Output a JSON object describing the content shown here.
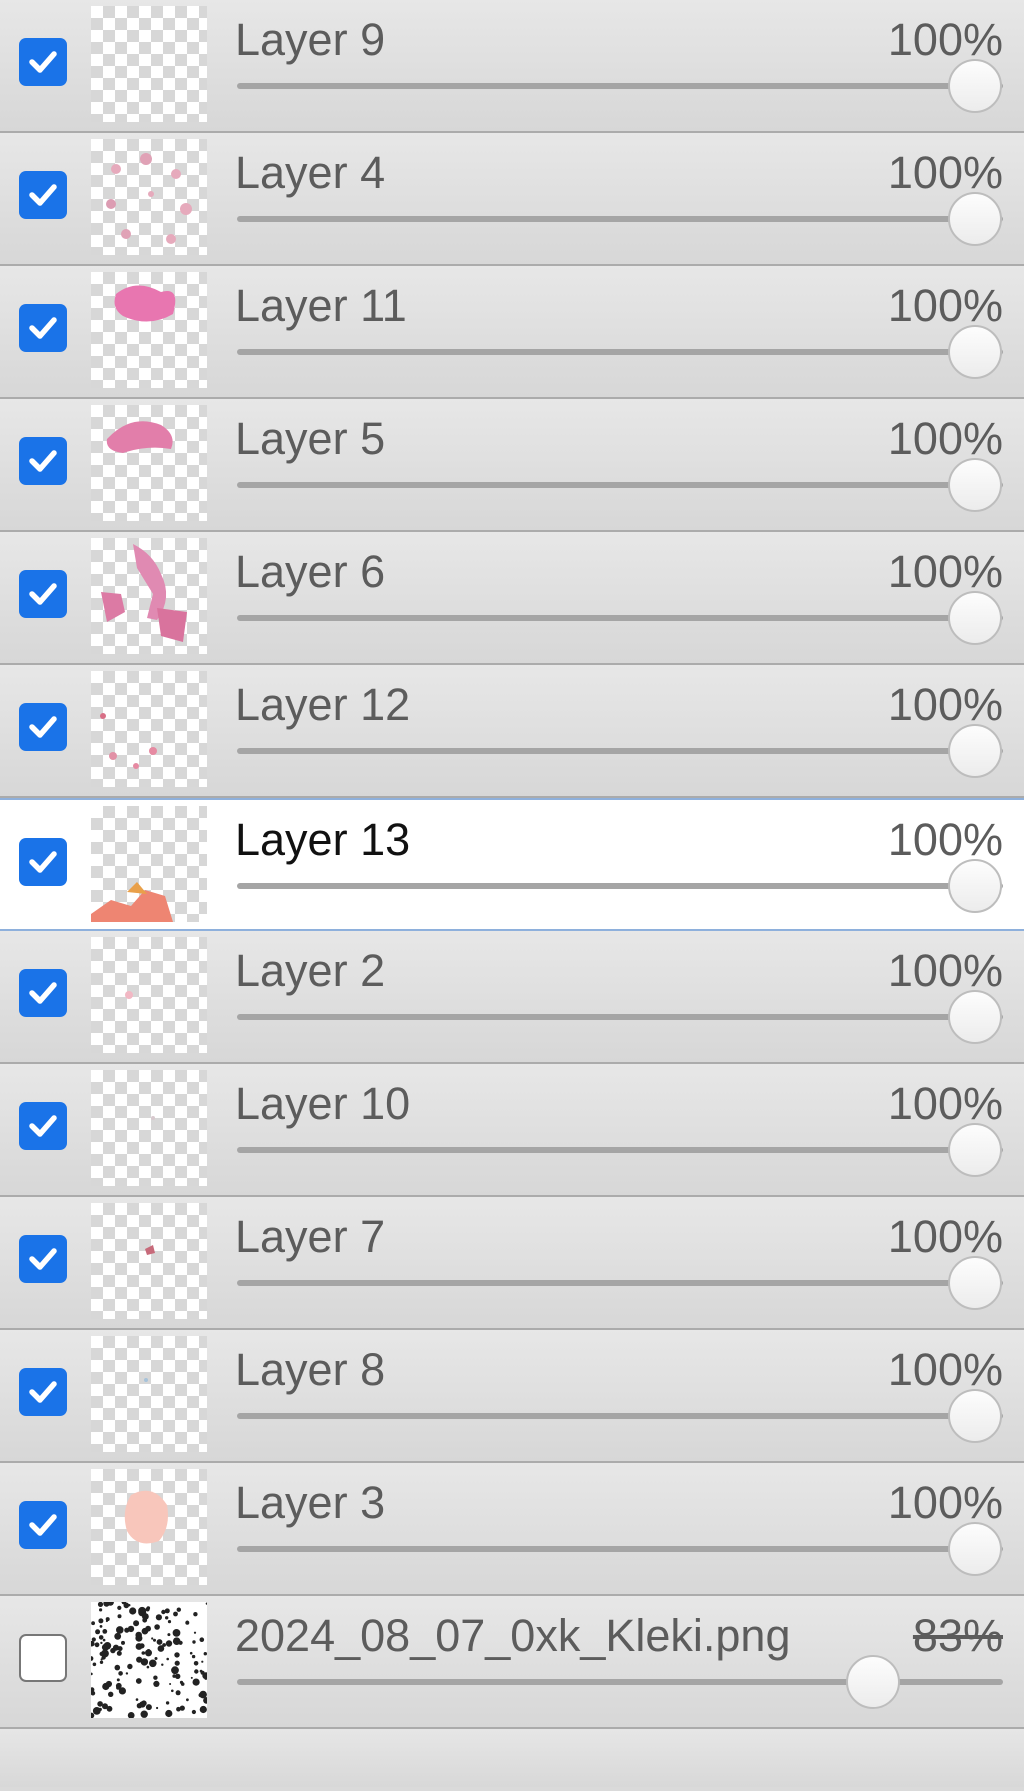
{
  "layers": [
    {
      "name": "Layer 9",
      "opacity_label": "100%",
      "opacity": 1.0,
      "visible": true,
      "selected": false
    },
    {
      "name": "Layer 4",
      "opacity_label": "100%",
      "opacity": 1.0,
      "visible": true,
      "selected": false
    },
    {
      "name": "Layer 11",
      "opacity_label": "100%",
      "opacity": 1.0,
      "visible": true,
      "selected": false
    },
    {
      "name": "Layer 5",
      "opacity_label": "100%",
      "opacity": 1.0,
      "visible": true,
      "selected": false
    },
    {
      "name": "Layer 6",
      "opacity_label": "100%",
      "opacity": 1.0,
      "visible": true,
      "selected": false
    },
    {
      "name": "Layer 12",
      "opacity_label": "100%",
      "opacity": 1.0,
      "visible": true,
      "selected": false
    },
    {
      "name": "Layer 13",
      "opacity_label": "100%",
      "opacity": 1.0,
      "visible": true,
      "selected": true
    },
    {
      "name": "Layer 2",
      "opacity_label": "100%",
      "opacity": 1.0,
      "visible": true,
      "selected": false
    },
    {
      "name": "Layer 10",
      "opacity_label": "100%",
      "opacity": 1.0,
      "visible": true,
      "selected": false
    },
    {
      "name": "Layer 7",
      "opacity_label": "100%",
      "opacity": 1.0,
      "visible": true,
      "selected": false
    },
    {
      "name": "Layer 8",
      "opacity_label": "100%",
      "opacity": 1.0,
      "visible": true,
      "selected": false
    },
    {
      "name": "Layer 3",
      "opacity_label": "100%",
      "opacity": 1.0,
      "visible": true,
      "selected": false
    },
    {
      "name": "2024_08_07_0xk_Kleki.png",
      "opacity_label": "83%",
      "opacity": 0.83,
      "visible": false,
      "selected": false
    }
  ],
  "colors": {
    "checkbox_accent": "#1a73e8",
    "selected_row_bg": "#ffffff",
    "selected_row_border": "#8eb0dc",
    "row_bg": "#dcdcdc"
  }
}
